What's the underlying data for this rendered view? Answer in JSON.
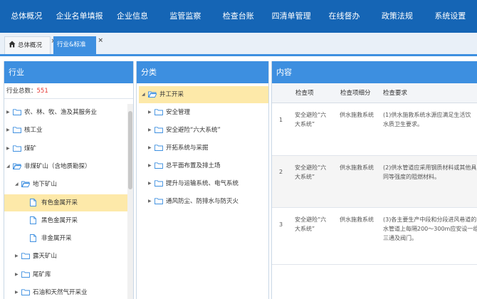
{
  "nav": [
    "总体概况",
    "企业名单填报",
    "企业信息",
    "监管监察",
    "检查台账",
    "四清单管理",
    "在线督办",
    "政策法规",
    "系统设置"
  ],
  "tabs": {
    "home_label": "总体概况",
    "active_label": "行业&标准",
    "close_glyph": "×"
  },
  "industry_panel": {
    "title": "行业",
    "count_label": "行业总数：",
    "count_value": "551",
    "items": [
      {
        "label": "农、林、牧、渔及其服务业",
        "kind": "folder",
        "level": 0,
        "expanded": false
      },
      {
        "label": "核工业",
        "kind": "folder",
        "level": 0,
        "expanded": false
      },
      {
        "label": "煤矿",
        "kind": "folder",
        "level": 0,
        "expanded": false
      },
      {
        "label": "非煤矿山（含地质勘探）",
        "kind": "folder",
        "level": 0,
        "expanded": true
      },
      {
        "label": "地下矿山",
        "kind": "folder",
        "level": 1,
        "expanded": true
      },
      {
        "label": "有色金属开采",
        "kind": "file",
        "level": 2,
        "selected": true
      },
      {
        "label": "黑色金属开采",
        "kind": "file",
        "level": 2
      },
      {
        "label": "非金属开采",
        "kind": "file",
        "level": 2
      },
      {
        "label": "露天矿山",
        "kind": "folder",
        "level": 1,
        "expanded": false
      },
      {
        "label": "尾矿库",
        "kind": "folder",
        "level": 1,
        "expanded": false
      },
      {
        "label": "石油和天然气开采业",
        "kind": "folder",
        "level": 1,
        "expanded": false
      }
    ]
  },
  "category_panel": {
    "title": "分类",
    "items": [
      {
        "label": "井工开采",
        "level": 0,
        "expanded": true,
        "selected": true
      },
      {
        "label": "安全管理",
        "level": 1
      },
      {
        "label": "安全避险“六大系统”",
        "level": 1
      },
      {
        "label": "开拓系统与采掘",
        "level": 1
      },
      {
        "label": "总平面布置及排土场",
        "level": 1
      },
      {
        "label": "提升与运输系统、电气系统",
        "level": 1
      },
      {
        "label": "通风防尘、防排水与防灭火",
        "level": 1
      }
    ]
  },
  "content_panel": {
    "title": "内容",
    "columns": [
      "检查项",
      "检查项细分",
      "检查要求"
    ],
    "rows": [
      {
        "no": "1",
        "item_lines": [
          "安全避险“六",
          "大系统”"
        ],
        "sub": "供水施救系统",
        "req_lines": [
          "(1)供水施救系统水源应满足生活饮",
          "水质卫生要求。"
        ]
      },
      {
        "no": "2",
        "item_lines": [
          "安全避险“六",
          "大系统”"
        ],
        "sub": "供水施救系统",
        "req_lines": [
          "(2)供水管道应采用钢质材料或其他具",
          "同等强度的阻燃材料。"
        ]
      },
      {
        "no": "3",
        "item_lines": [
          "安全避险“六",
          "大系统”"
        ],
        "sub": "供水施救系统",
        "req_lines": [
          "(3)各主要生产中段和分段进风巷道的",
          "水管道上每隔200～300m应安设一组",
          "三通及阀门。"
        ]
      }
    ]
  }
}
